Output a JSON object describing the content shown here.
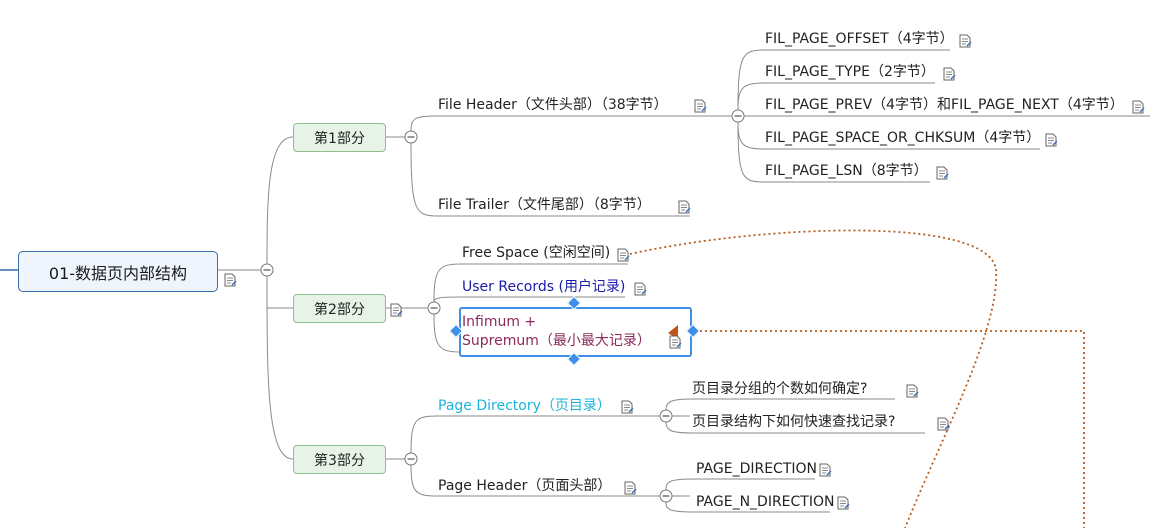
{
  "root": {
    "label": "01-数据页内部结构"
  },
  "parts": [
    {
      "label": "第1部分"
    },
    {
      "label": "第2部分"
    },
    {
      "label": "第3部分"
    }
  ],
  "part1": {
    "file_header": "File Header（文件头部）（38字节）",
    "file_trailer": "File Trailer（文件尾部）（8字节）",
    "header_fields": [
      "FIL_PAGE_OFFSET（4字节）",
      "FIL_PAGE_TYPE（2字节）",
      "FIL_PAGE_PREV（4字节）和FIL_PAGE_NEXT（4字节）",
      "FIL_PAGE_SPACE_OR_CHKSUM（4字节）",
      "FIL_PAGE_LSN（8字节）"
    ]
  },
  "part2": {
    "free_space": "Free Space (空闲空间)",
    "user_records": "User Records (用户记录)",
    "infimum_line1": "Infimum +",
    "infimum_line2": "Supremum（最小最大记录）"
  },
  "part3": {
    "page_directory": "Page Directory（页目录）",
    "page_header": "Page Header（页面头部）",
    "directory_questions": [
      "页目录分组的个数如何确定?",
      "页目录结构下如何快速查找记录?"
    ],
    "header_fields": [
      "PAGE_DIRECTION",
      "PAGE_N_DIRECTION"
    ]
  },
  "colors": {
    "user_records": "#1a1aa8",
    "infimum": "#8b2a5c",
    "page_directory": "#19b5dc",
    "relationship": "#b85c1e",
    "selection": "#3d8fe8"
  },
  "icons": {
    "note": "note-icon",
    "collapse": "collapse-toggle-icon"
  }
}
